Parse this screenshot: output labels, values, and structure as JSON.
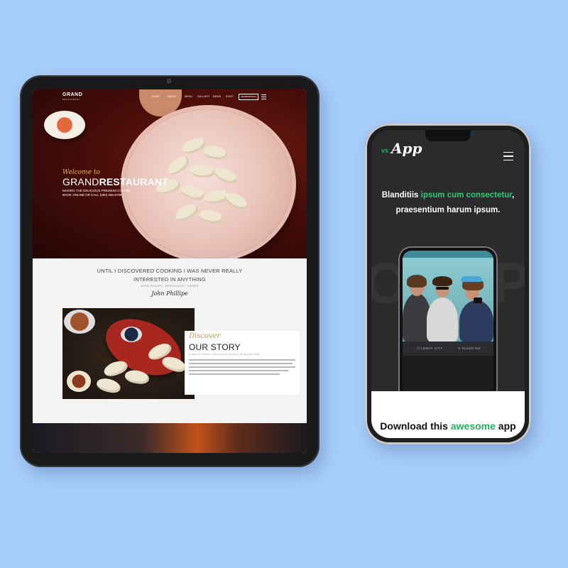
{
  "tablet": {
    "nav": {
      "logo": "GRAND",
      "logo_sub": "RESTAURANT",
      "links": [
        "HOME",
        "ABOUT",
        "MENU",
        "GALLERY",
        "NEWS",
        "SHOP"
      ],
      "cta": "RESERVATION"
    },
    "hero": {
      "welcome": "Welcome to",
      "title_light": "GRAND",
      "title_bold": "RESTAURANT",
      "line1": "MAKING THE DELICIOUS PREMIUM COFFEE",
      "line2": "BOOK ONLINE OR CALL (080) 456-6789"
    },
    "quote": {
      "line1": "UNTIL I DISCOVERED COOKING I WAS NEVER REALLY",
      "line2": "INTERESTED IN ANYTHING",
      "author": "JOHN PHILIPE, RESTAURANT OWNER",
      "signature": "John Phillipe"
    },
    "story": {
      "discover": "Discover",
      "title": "OUR STORY",
      "subtitle": "ALWAYS FRESH, DELICIOUS FOOD FOR EVERYONE"
    }
  },
  "phone": {
    "logo_vs": "vs",
    "logo_app": "App",
    "headline": {
      "part1": "Blanditiis ",
      "green1": "ipsum cum consectetur",
      "part2": ", praesentium harum ipsum."
    },
    "inner": {
      "left_label": "☐ LEMAY CITY",
      "right_label": "✈ FLASH GO"
    },
    "download": {
      "part1": "Download this ",
      "green": "awesome",
      "part2": " app"
    }
  },
  "colors": {
    "background": "#a7cdfb",
    "accent_green": "#27ae60",
    "gold": "#c69448"
  }
}
